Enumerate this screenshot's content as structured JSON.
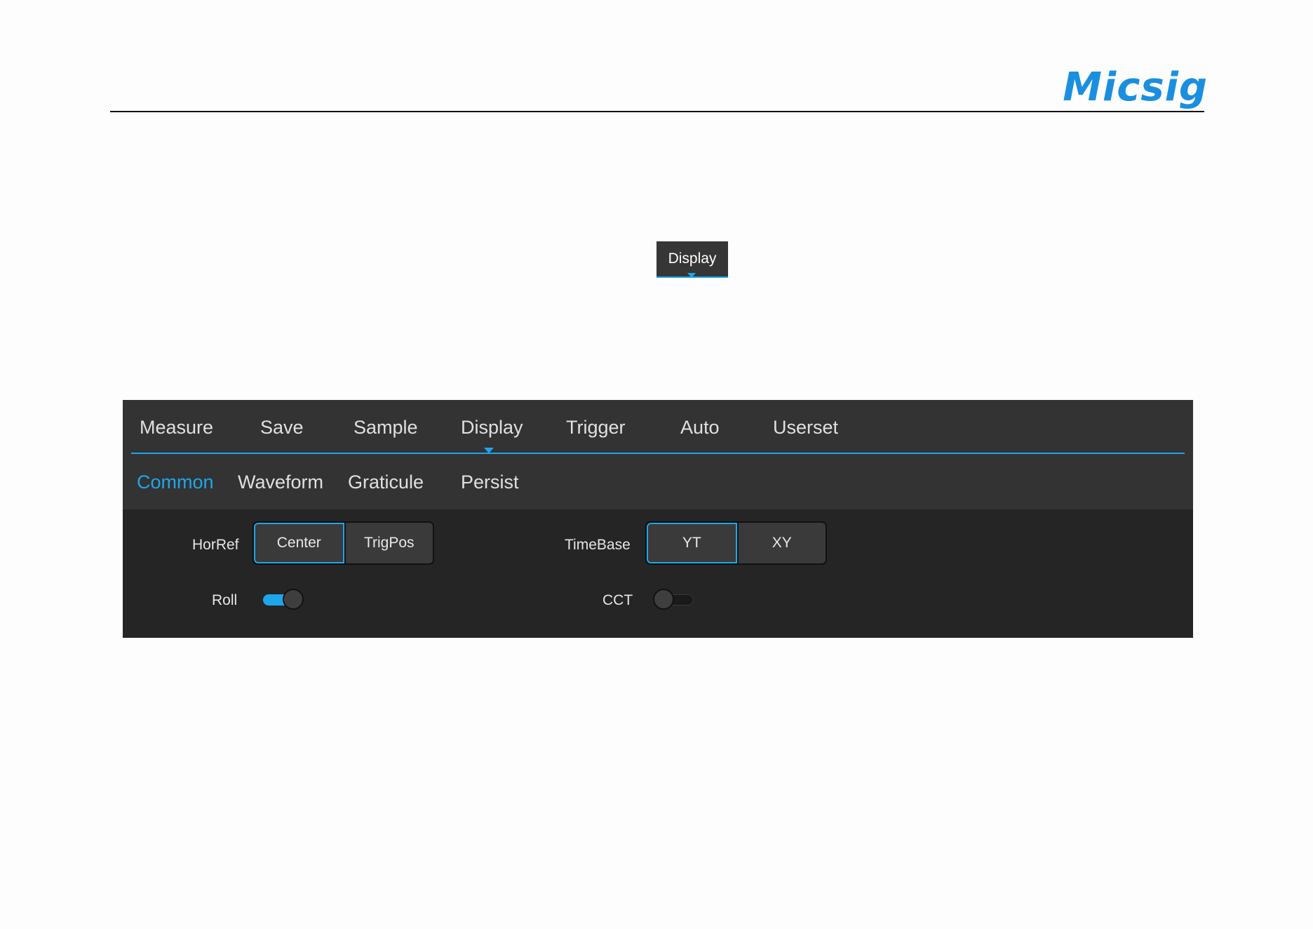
{
  "brand": {
    "logo_text": "Micsig",
    "logo_color": "#1a8fe0"
  },
  "badge": {
    "label": "Display"
  },
  "menu": {
    "items": [
      {
        "label": "Measure"
      },
      {
        "label": "Save"
      },
      {
        "label": "Sample"
      },
      {
        "label": "Display",
        "active": true
      },
      {
        "label": "Trigger"
      },
      {
        "label": "Auto"
      },
      {
        "label": "Userset"
      }
    ]
  },
  "submenu": {
    "items": [
      {
        "label": "Common",
        "active": true
      },
      {
        "label": "Waveform"
      },
      {
        "label": "Graticule"
      },
      {
        "label": "Persist"
      }
    ]
  },
  "settings": {
    "horref": {
      "label": "HorRef",
      "options": [
        "Center",
        "TrigPos"
      ],
      "selected": "Center"
    },
    "timebase": {
      "label": "TimeBase",
      "options": [
        "YT",
        "XY"
      ],
      "selected": "YT"
    },
    "roll": {
      "label": "Roll",
      "on": true
    },
    "cct": {
      "label": "CCT",
      "on": false
    }
  },
  "colors": {
    "accent": "#1ea6ea",
    "panel_bg": "#252525",
    "menu_bg": "#333333"
  }
}
